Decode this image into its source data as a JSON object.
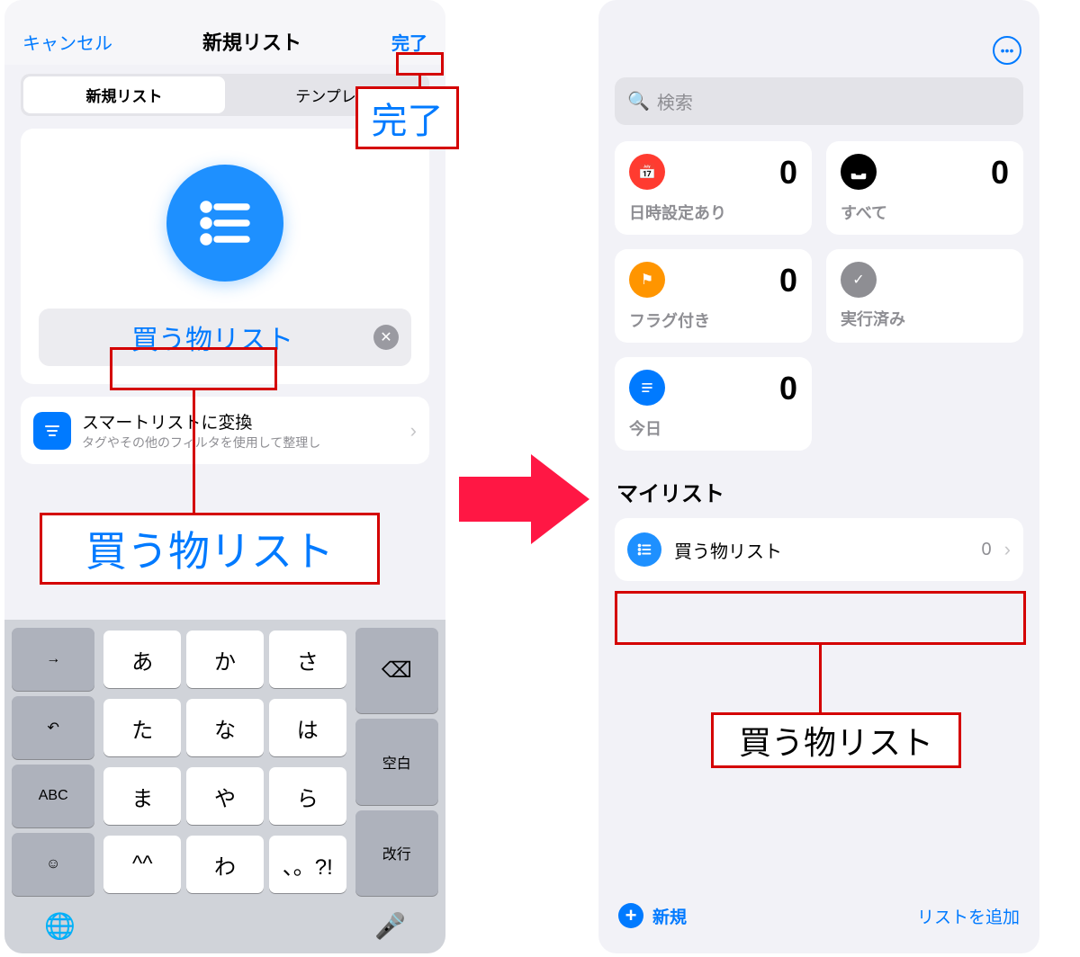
{
  "left": {
    "cancel": "キャンセル",
    "title": "新規リスト",
    "done": "完了",
    "seg_new": "新規リスト",
    "seg_tpl": "テンプレ",
    "list_name": "買う物リスト",
    "smart_title": "スマートリストに変換",
    "smart_sub": "タグやその他のフィルタを使用して整理し"
  },
  "keyboard": {
    "rows": [
      [
        "→",
        "あ",
        "か",
        "さ",
        "⌫"
      ],
      [
        "↶",
        "た",
        "な",
        "は",
        "空白"
      ],
      [
        "ABC",
        "ま",
        "や",
        "ら",
        "改行"
      ],
      [
        "☺",
        "^^",
        "わ",
        "、。?!",
        ""
      ]
    ]
  },
  "right": {
    "search_ph": "検索",
    "tiles": [
      {
        "label": "日時設定あり",
        "count": "0",
        "color": "#ff3b30",
        "icon": "cal"
      },
      {
        "label": "すべて",
        "count": "0",
        "color": "#000",
        "icon": "tray"
      },
      {
        "label": "フラグ付き",
        "count": "0",
        "color": "#ff9500",
        "icon": "flag"
      },
      {
        "label": "実行済み",
        "count": "",
        "color": "#8e8e93",
        "icon": "check"
      },
      {
        "label": "今日",
        "count": "0",
        "color": "#007aff",
        "icon": "list"
      }
    ],
    "section": "マイリスト",
    "list_name": "買う物リスト",
    "list_count": "0",
    "new_label": "新規",
    "add_list": "リストを追加"
  },
  "callouts": {
    "done_big": "完了",
    "name_big": "買う物リスト",
    "name_right": "買う物リスト"
  }
}
